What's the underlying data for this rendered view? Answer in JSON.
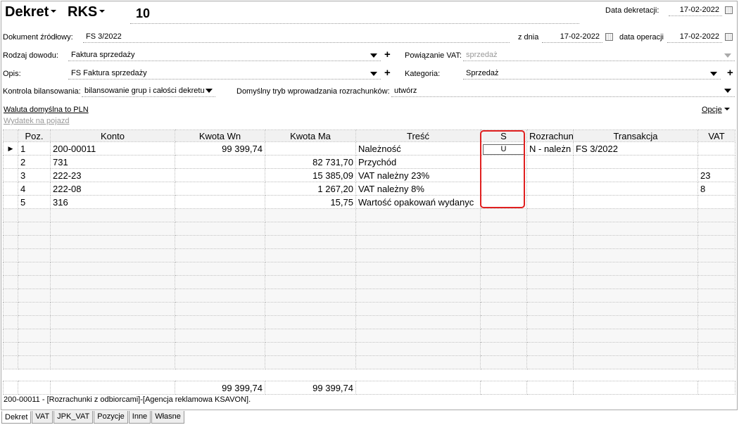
{
  "header": {
    "doc_type": "Dekret",
    "journal": "RKS",
    "number": "10",
    "date_label": "Data dekretacji:",
    "date_value": "17-02-2022"
  },
  "source": {
    "label": "Dokument źródłowy:",
    "value": "FS 3/2022",
    "from_label": "z dnia",
    "from_value": "17-02-2022",
    "op_label": "data operacji",
    "op_value": "17-02-2022"
  },
  "proof": {
    "label": "Rodzaj dowodu:",
    "value": "Faktura sprzedaży"
  },
  "vat_link": {
    "label": "Powiązanie VAT:",
    "value": "sprzedaż"
  },
  "desc": {
    "label": "Opis:",
    "value": "FS Faktura sprzedaży"
  },
  "category": {
    "label": "Kategoria:",
    "value": "Sprzedaż"
  },
  "balance": {
    "label": "Kontrola bilansowania:",
    "value": "bilansowanie grup i całości dekretu"
  },
  "settle_mode": {
    "label": "Domyślny tryb wprowadzania rozrachunków:",
    "value": "utwórz"
  },
  "links": {
    "currency": "Waluta domyślna to PLN",
    "vehicle": "Wydatek na pojazd",
    "options": "Opcje"
  },
  "columns": [
    "Poz.",
    "Konto",
    "Kwota Wn",
    "Kwota Ma",
    "Treść",
    "S",
    "Rozrachun",
    "Transakcja",
    "VAT"
  ],
  "rows": [
    {
      "poz": "1",
      "konto": "200-00011",
      "wn": "99 399,74",
      "ma": "",
      "tresc": "Należność",
      "s": "U",
      "rozrachun": "N - należn",
      "transakcja": "FS 3/2022",
      "vat": ""
    },
    {
      "poz": "2",
      "konto": "731",
      "wn": "",
      "ma": "82 731,70",
      "tresc": "Przychód",
      "s": "",
      "rozrachun": "",
      "transakcja": "",
      "vat": ""
    },
    {
      "poz": "3",
      "konto": "222-23",
      "wn": "",
      "ma": "15 385,09",
      "tresc": "VAT należny 23%",
      "s": "",
      "rozrachun": "",
      "transakcja": "",
      "vat": "23"
    },
    {
      "poz": "4",
      "konto": "222-08",
      "wn": "",
      "ma": "1 267,20",
      "tresc": "VAT należny 8%",
      "s": "",
      "rozrachun": "",
      "transakcja": "",
      "vat": "8"
    },
    {
      "poz": "5",
      "konto": "316",
      "wn": "",
      "ma": "15,75",
      "tresc": "Wartość opakowań wydanyc",
      "s": "",
      "rozrachun": "",
      "transakcja": "",
      "vat": ""
    }
  ],
  "totals": {
    "wn": "99 399,74",
    "ma": "99 399,74"
  },
  "status": "200-00011 - [Rozrachunki z odbiorcami]-[Agencja reklamowa KSAVON].",
  "tabs": [
    "Dekret",
    "VAT",
    "JPK_VAT",
    "Pozycje",
    "Inne",
    "Własne"
  ]
}
